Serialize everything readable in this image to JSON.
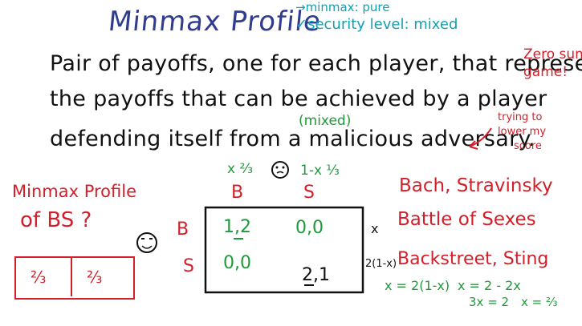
{
  "title": "Minmax Profile",
  "notes": {
    "pure": "→minmax: pure",
    "mixed": "✓security level: mixed"
  },
  "definition": {
    "line1": "Pair of payoffs, one for each player, that represent",
    "line2": "the payoffs that can be achieved by a player",
    "line3": "defending itself from a malicious adversary.",
    "mixed_insert": "(mixed)"
  },
  "side_notes": {
    "zero_sum_line1": "Zero sum",
    "zero_sum_line2": "game!",
    "trying_line1": "trying to",
    "trying_line2": "lower my",
    "trying_line3": "score"
  },
  "question": {
    "line1": "Minmax Profile",
    "line2": "of BS ?"
  },
  "matrix": {
    "col_prob_1": "x ⅔",
    "col_prob_2": "1-x ⅓",
    "col_headers": [
      "B",
      "S"
    ],
    "row_headers": [
      "B",
      "S"
    ],
    "cells": [
      [
        "1,2",
        "0,0"
      ],
      [
        "0,0",
        "2,1"
      ]
    ],
    "row_label_1": "x",
    "row_label_2": "2(1-x)"
  },
  "game_names": {
    "line1": "Bach, Stravinsky",
    "line2": "Battle of Sexes",
    "line3": "Backstreet, Sting"
  },
  "equations": {
    "eq1": "x = 2(1-x)",
    "eq2": "x = 2 - 2x",
    "eq3": "3x = 2",
    "eq4": "x = ⅔"
  },
  "answer": [
    "⅔",
    "⅔"
  ],
  "colors": {
    "title": "#2f3c8f",
    "text": "#111111",
    "teal": "#13a0b0",
    "green": "#1f9a3a",
    "red": "#d21f2a"
  },
  "icons": [
    "thinking-face-icon",
    "smiley-face-icon",
    "arrow-icon"
  ]
}
